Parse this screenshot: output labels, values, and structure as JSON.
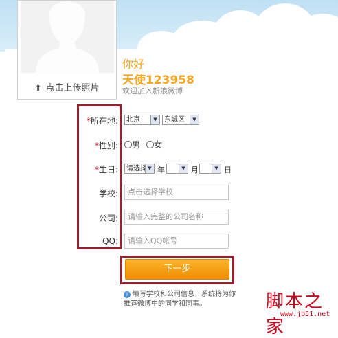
{
  "profile": {
    "upload_label": "点击上传照片",
    "greeting": "你好",
    "username": "天使123958",
    "welcome": "欢迎加入新浪微博"
  },
  "form": {
    "location": {
      "label": "所在地:",
      "required": true,
      "province": "北京",
      "district": "东城区"
    },
    "gender": {
      "label": "性别:",
      "required": true,
      "options": [
        "男",
        "女"
      ]
    },
    "birthday": {
      "label": "生日:",
      "required": true,
      "year_select": "请选择",
      "year_unit": "年",
      "month_unit": "月",
      "day_unit": "日"
    },
    "school": {
      "label": "学校:",
      "placeholder": "点击选择学校"
    },
    "company": {
      "label": "公司:",
      "placeholder": "请输入完整的公司名称"
    },
    "qq": {
      "label": "QQ:",
      "placeholder": "请输入QQ帐号"
    },
    "required_mark": "*"
  },
  "next_button": "下一步",
  "hint": "填写学校和公司信息，系统将为你推荐微博中的同学和同事。",
  "watermark": {
    "logo": "脚本之家",
    "url": "www.jb51.net"
  },
  "colors": {
    "accent": "#f5a623",
    "button": "#f39c12",
    "frame": "#9c1f2c",
    "required": "#d0021b"
  },
  "icons": [
    "upload-icon",
    "info-icon",
    "chevron-down-icon"
  ]
}
